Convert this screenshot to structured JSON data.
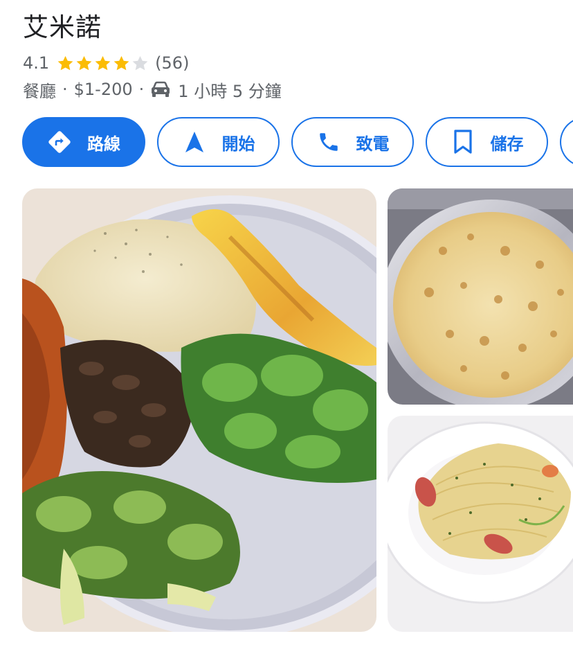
{
  "place": {
    "name": "艾米諾",
    "rating": "4.1",
    "rating_value": 4.1,
    "review_count": "(56)",
    "category": "餐廳",
    "separator": "·",
    "price_range": "$1-200",
    "travel_time": "1 小時 5 分鐘"
  },
  "actions": [
    {
      "label": "路線",
      "icon": "directions-icon"
    },
    {
      "label": "開始",
      "icon": "navigation-arrow-icon"
    },
    {
      "label": "致電",
      "icon": "phone-icon"
    },
    {
      "label": "儲存",
      "icon": "bookmark-icon"
    }
  ],
  "photos": [
    {
      "name": "photo-rice-plate"
    },
    {
      "name": "photo-baked-cheese"
    },
    {
      "name": "photo-spaghetti"
    }
  ],
  "colors": {
    "accent": "#1a73e8",
    "star": "#fbbc04",
    "star_empty": "#dadce0",
    "text_secondary": "#5f6368"
  }
}
